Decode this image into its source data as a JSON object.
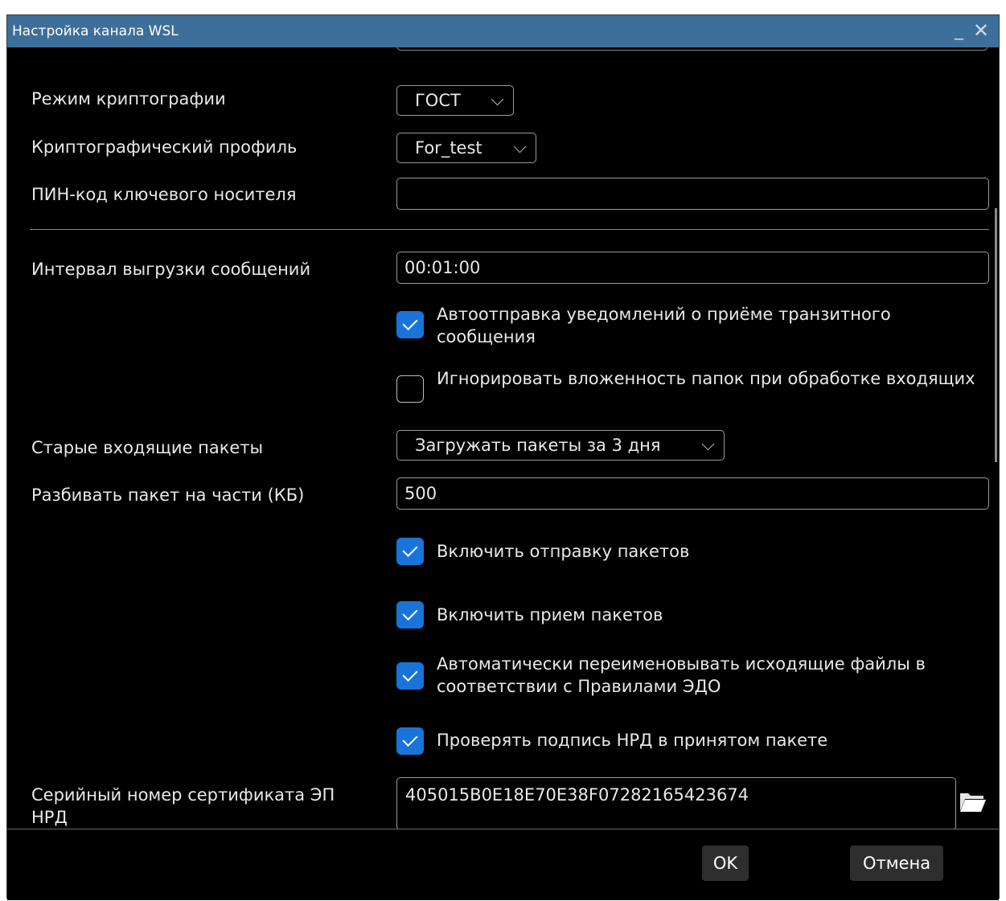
{
  "window": {
    "title": "Настройка канала WSL",
    "minimize_glyph": "_",
    "close_glyph": "✕"
  },
  "form": {
    "crypto_mode": {
      "label": "Режим криптографии",
      "value": "ГОСТ"
    },
    "crypto_profile": {
      "label": "Криптографический профиль",
      "value": "For_test"
    },
    "pin": {
      "label": "ПИН-код ключевого носителя",
      "value": ""
    },
    "upload_interval": {
      "label": "Интервал выгрузки сообщений",
      "value": "00:01:00"
    },
    "auto_notify": {
      "label": "Автоотправка уведомлений о приёме транзитного сообщения",
      "checked": true
    },
    "ignore_folders": {
      "label": "Игнорировать вложенность папок при обработке входящих",
      "checked": false
    },
    "old_packets": {
      "label": "Старые входящие пакеты",
      "value": "Загружать пакеты за 3 дня"
    },
    "split_packet": {
      "label": "Разбивать пакет на части (КБ)",
      "value": "500"
    },
    "enable_send": {
      "label": "Включить отправку пакетов",
      "checked": true
    },
    "enable_receive": {
      "label": "Включить прием пакетов",
      "checked": true
    },
    "auto_rename": {
      "label": "Автоматически переименовывать исходящие файлы в соответствии с Правилами ЭДО",
      "checked": true
    },
    "verify_signature": {
      "label": "Проверять подпись НРД в принятом пакете",
      "checked": true
    },
    "cert_serial": {
      "label": "Серийный номер сертификата ЭП НРД",
      "value": "405015B0E18E70E38F07282165423674"
    }
  },
  "footer": {
    "ok_label": "OK",
    "cancel_label": "Отмена"
  },
  "colors": {
    "titlebar": "#3d6f9a",
    "checkbox_on": "#1a73d9",
    "background": "#000000"
  }
}
